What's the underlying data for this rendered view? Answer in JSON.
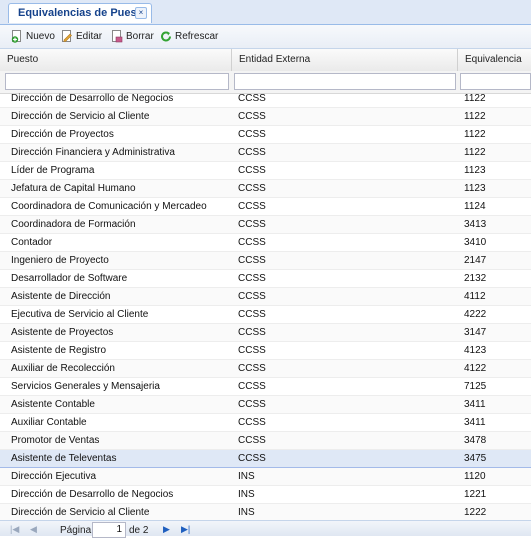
{
  "tab": {
    "title": "Equivalencias de Puesto",
    "close_glyph": "×"
  },
  "toolbar": {
    "new_label": "Nuevo",
    "edit_label": "Editar",
    "delete_label": "Borrar",
    "refresh_label": "Refrescar"
  },
  "grid": {
    "columns": [
      "Puesto",
      "Entidad Externa",
      "Equivalencia"
    ],
    "rows": [
      [
        "Dirección de Desarrollo de Negocios",
        "CCSS",
        "1122"
      ],
      [
        "Dirección de Servicio al Cliente",
        "CCSS",
        "1122"
      ],
      [
        "Dirección de Proyectos",
        "CCSS",
        "1122"
      ],
      [
        "Dirección Financiera y Administrativa",
        "CCSS",
        "1122"
      ],
      [
        "Líder de Programa",
        "CCSS",
        "1123"
      ],
      [
        "Jefatura de Capital Humano",
        "CCSS",
        "1123"
      ],
      [
        "Coordinadora de Comunicación y Mercadeo",
        "CCSS",
        "1124"
      ],
      [
        "Coordinadora de Formación",
        "CCSS",
        "3413"
      ],
      [
        "Contador",
        "CCSS",
        "3410"
      ],
      [
        "Ingeniero de Proyecto",
        "CCSS",
        "2147"
      ],
      [
        "Desarrollador de Software",
        "CCSS",
        "2132"
      ],
      [
        "Asistente de Dirección",
        "CCSS",
        "4112"
      ],
      [
        "Ejecutiva de Servicio al Cliente",
        "CCSS",
        "4222"
      ],
      [
        "Asistente de Proyectos",
        "CCSS",
        "3147"
      ],
      [
        "Asistente de Registro",
        "CCSS",
        "4123"
      ],
      [
        "Auxiliar de Recolección",
        "CCSS",
        "4122"
      ],
      [
        "Servicios Generales y Mensajeria",
        "CCSS",
        "7125"
      ],
      [
        "Asistente Contable",
        "CCSS",
        "3411"
      ],
      [
        "Auxiliar Contable",
        "CCSS",
        "3411"
      ],
      [
        "Promotor de Ventas",
        "CCSS",
        "3478"
      ],
      [
        "Asistente de Televentas",
        "CCSS",
        "3475"
      ],
      [
        "Dirección Ejecutiva",
        "INS",
        "1120"
      ],
      [
        "Dirección de Desarrollo de Negocios",
        "INS",
        "1221"
      ],
      [
        "Dirección de Servicio al Cliente",
        "INS",
        "1222"
      ]
    ],
    "selected_index": 20
  },
  "pager": {
    "page_label": "Página",
    "page_value": "1",
    "of_label": "de 2"
  },
  "colors": {
    "header_blue": "#15428b",
    "selected_row": "#dfe8f6",
    "new_icon": "#2e9d2e",
    "refresh_icon": "#33a333",
    "edit_icon": "#e2a636",
    "delete_icon": "#c85a8a"
  }
}
